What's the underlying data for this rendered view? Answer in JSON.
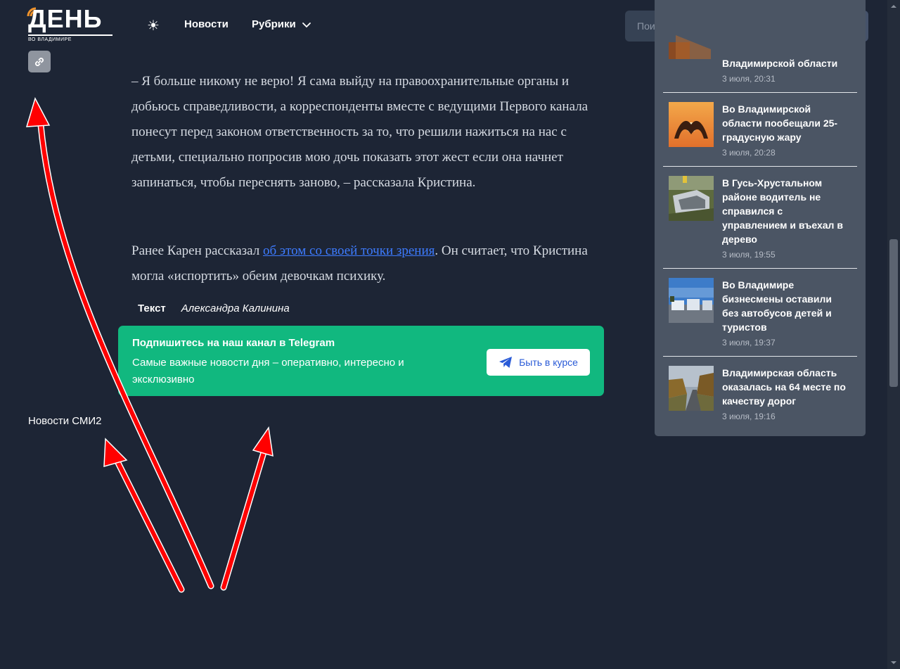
{
  "header": {
    "logo_text": "ДЕНЬ",
    "logo_subtext": "ВО ВЛАДИМИРЕ",
    "theme_icon": "☀",
    "nav": {
      "news": "Новости",
      "rubrics": "Рубрики"
    },
    "search": {
      "placeholder": "Поиск"
    }
  },
  "article": {
    "paragraph1": "– Я больше никому не верю! Я сама выйду на правоохранительные органы и добьюсь справедливости, а корреспонденты вместе с ведущими Первого канала понесут перед законом ответственность за то, что решили нажиться на нас с детьми, специально попросив мою дочь показать этот жест если она начнет запинаться, чтобы переснять заново, – рассказала Кристина.",
    "paragraph2_before": "Ранее Карен рассказал ",
    "paragraph2_link": "об этом со своей точки зрения",
    "paragraph2_after": ". Он считает, что Кристина могла «испортить» обеим девочкам психику.",
    "credit_label": "Текст",
    "credit_name": "Александра Калинина"
  },
  "telegram": {
    "title": "Подпишитесь на наш канал в Telegram",
    "description": "Самые важные новости дня – оперативно, интересно и эксклюзивно",
    "button_label": "Быть в курсе"
  },
  "smi_label": "Новости СМИ2",
  "sidebar": {
    "items": [
      {
        "title_visible": "Владимирской области",
        "date": "3 июля, 20:31"
      },
      {
        "title": "Во Владимирской области пообещали 25-градусную жару",
        "date": "3 июля, 20:28"
      },
      {
        "title": "В Гусь-Хрустальном районе водитель не справился с управлением и въехал в дерево",
        "date": "3 июля, 19:55"
      },
      {
        "title": "Во Владимире бизнесмены оставили без автобусов детей и туристов",
        "date": "3 июля, 19:37"
      },
      {
        "title": "Владимирская область оказалась на 64 месте по качеству дорог",
        "date": "3 июля, 19:16"
      }
    ]
  },
  "colors": {
    "background": "#1d2535",
    "accent_orange": "#f0932b",
    "telegram_green": "#11b87f",
    "link_blue": "#3d7bff",
    "sidebar_bg": "#4b5564",
    "arrow_red": "#ff0000"
  }
}
